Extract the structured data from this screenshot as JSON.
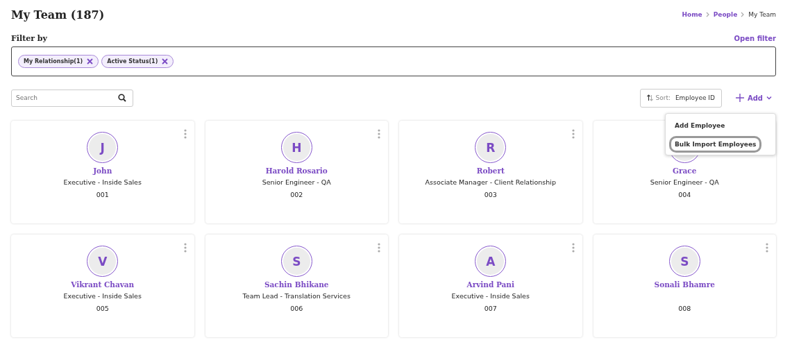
{
  "page": {
    "title": "My Team (187)"
  },
  "breadcrumbs": [
    {
      "label": "Home",
      "link": true
    },
    {
      "label": "People",
      "link": true
    },
    {
      "label": "My Team",
      "link": false
    }
  ],
  "filter": {
    "label": "Filter by",
    "open_filter": "Open filter",
    "chips": [
      "My Relationship(1)",
      "Active Status(1)"
    ]
  },
  "search": {
    "placeholder": "Search"
  },
  "sort": {
    "label": "Sort:",
    "value": "Employee ID"
  },
  "add": {
    "label": "Add",
    "expanded": true,
    "menu": [
      {
        "label": "Add Employee",
        "selected": false
      },
      {
        "label": "Bulk Import Employees",
        "selected": true
      }
    ]
  },
  "employees": [
    {
      "initial": "J",
      "name": "John",
      "designation": "Executive - Inside Sales",
      "id": "001"
    },
    {
      "initial": "H",
      "name": "Harold Rosario",
      "designation": "Senior Engineer - QA",
      "id": "002"
    },
    {
      "initial": "R",
      "name": "Robert",
      "designation": "Associate Manager - Client Relationship",
      "id": "003"
    },
    {
      "name": "Grace",
      "designation": "Senior Engineer - QA",
      "id": "004"
    },
    {
      "initial": "V",
      "name": "Vikrant Chavan",
      "designation": "Executive - Inside Sales",
      "id": "005"
    },
    {
      "initial": "S",
      "name": "Sachin Bhikane",
      "designation": "Team Lead - Translation Services",
      "id": "006"
    },
    {
      "initial": "A",
      "name": "Arvind Pani",
      "designation": "Executive - Inside Sales",
      "id": "007"
    },
    {
      "initial": "S",
      "name": "Sonali Bhamre",
      "id": "008"
    }
  ]
}
